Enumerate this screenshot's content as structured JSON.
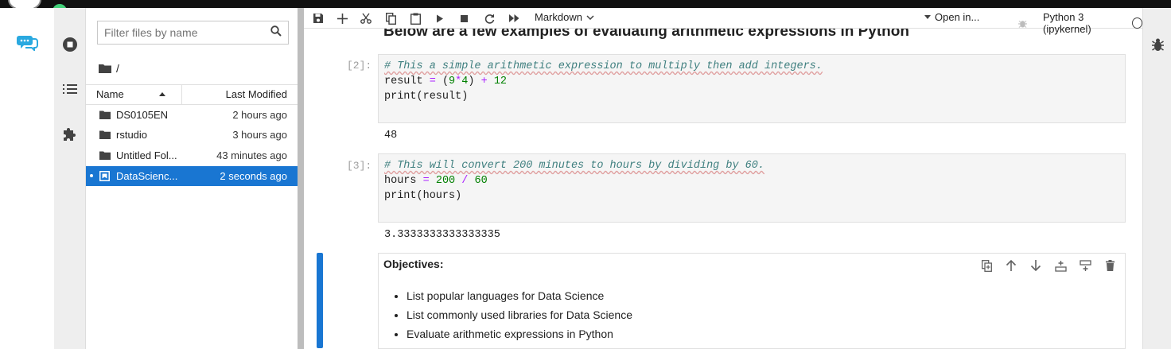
{
  "filebrowser": {
    "filter_placeholder": "Filter files by name",
    "path": "/",
    "col_name": "Name",
    "col_modified": "Last Modified",
    "items": [
      {
        "name": "DS0105EN",
        "modified": "2 hours ago",
        "type": "folder"
      },
      {
        "name": "rstudio",
        "modified": "3 hours ago",
        "type": "folder"
      },
      {
        "name": "Untitled Fol...",
        "modified": "43 minutes ago",
        "type": "folder"
      },
      {
        "name": "DataScienc...",
        "modified": "2 seconds ago",
        "type": "notebook",
        "selected": true
      }
    ]
  },
  "toolbar": {
    "cell_type": "Markdown",
    "open_in": "Open in...",
    "kernel": "Python 3 (ipykernel)"
  },
  "notebook": {
    "partial_heading": "Below are a few examples of evaluating arithmetic expressions in Python",
    "cells": [
      {
        "prompt": "[2]:",
        "comment": "# This a simple arithmetic expression to multiply then add integers.",
        "line2_var": "result",
        "line2_eq": "=",
        "line2_open": "(",
        "line2_n1": "9",
        "line2_op": "*",
        "line2_n2": "4",
        "line2_close": ")",
        "line2_plus": "+",
        "line2_n3": "12",
        "line3": "print(result)",
        "output": "48"
      },
      {
        "prompt": "[3]:",
        "comment": "# This will convert 200 minutes to hours by dividing by 60.",
        "line2_var": "hours",
        "line2_eq": "=",
        "line2_n1": "200",
        "line2_op": "/",
        "line2_n2": "60",
        "line3": "print(hours)",
        "output": "3.3333333333333335"
      }
    ],
    "markdown": {
      "heading": "Objectives:",
      "bullets": [
        "List popular languages for Data Science",
        "List commonly used libraries for Data Science",
        "Evaluate arithmetic expressions in Python"
      ]
    }
  },
  "colors": {
    "accent": "#1976d2",
    "status_dot": "#43d17a",
    "comment": "#408080",
    "number": "#008000",
    "operator": "#aa22ff"
  }
}
